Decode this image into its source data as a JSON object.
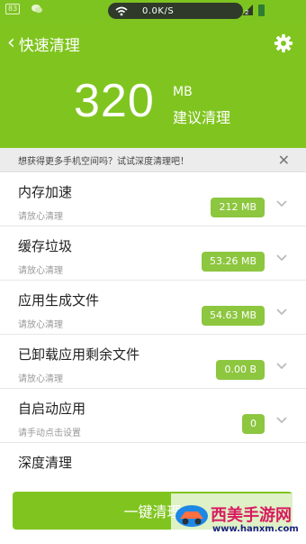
{
  "status_bar": {
    "left_badge": "83",
    "speed": "0.0K/S",
    "icons": [
      "sim-badge-icon",
      "chat-icon",
      "wifi-icon",
      "signal-icon",
      "battery-icon"
    ]
  },
  "header": {
    "back_icon": "chevron-left-icon",
    "title": "快速清理",
    "settings_icon": "gear-icon"
  },
  "summary": {
    "amount": "320",
    "unit": "MB",
    "label": "建议清理"
  },
  "tip": {
    "text": "想获得更多手机空间吗？试试深度清理吧！",
    "close_icon": "close-icon"
  },
  "items": [
    {
      "title": "内存加速",
      "subtitle": "请放心清理",
      "value": "212 MB"
    },
    {
      "title": "缓存垃圾",
      "subtitle": "请放心清理",
      "value": "53.26 MB"
    },
    {
      "title": "应用生成文件",
      "subtitle": "请放心清理",
      "value": "54.63 MB"
    },
    {
      "title": "已卸载应用剩余文件",
      "subtitle": "请放心清理",
      "value": "0.00 B"
    },
    {
      "title": "自启动应用",
      "subtitle": "请手动点击设置",
      "value": "0"
    },
    {
      "title": "深度清理",
      "subtitle": "",
      "value": ""
    }
  ],
  "action_button": {
    "label": "一键清理"
  },
  "watermark": {
    "title": "西美手游网",
    "url": "www.hanxm.com"
  },
  "colors": {
    "accent": "#80c51f",
    "value_pill": "#8dc63f",
    "tip_bg": "#ececec"
  }
}
